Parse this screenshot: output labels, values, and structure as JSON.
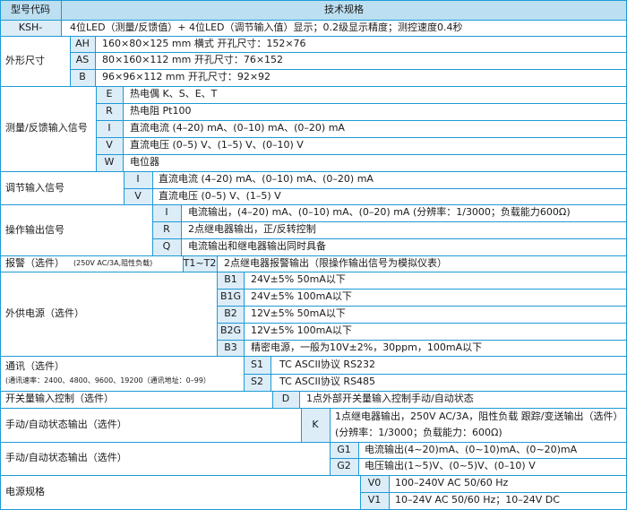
{
  "header": {
    "code_col": "型号代码",
    "spec_col": "技术规格"
  },
  "rows": {
    "model": {
      "code": "KSH-",
      "desc": "4位LED（测量/反馈值）+ 4位LED（调节输入值）显示；0.2级显示精度；测控速度0.4秒"
    },
    "size": {
      "label": "外形尺寸",
      "items": [
        {
          "code": "AH",
          "desc": "160×80×125 mm  横式    开孔尺寸：152×76"
        },
        {
          "code": "AS",
          "desc": "80×160×112 mm      开孔尺寸：76×152"
        },
        {
          "code": "B",
          "desc": "96×96×112 mm       开孔尺寸：92×92"
        }
      ]
    },
    "measure": {
      "label": "测量/反馈输入信号",
      "items": [
        {
          "code": "E",
          "desc": "热电偶 K、S、E、T"
        },
        {
          "code": "R",
          "desc": "热电阻 Pt100"
        },
        {
          "code": "I",
          "desc": "直流电流 (4–20) mA、(0–10) mA、(0–20) mA"
        },
        {
          "code": "V",
          "desc": "直流电压 (0–5) V、(1–5) V、(0–10) V"
        },
        {
          "code": "W",
          "desc": "电位器"
        }
      ]
    },
    "regulate": {
      "label": "调节输入信号",
      "items": [
        {
          "code": "I",
          "desc": "直流电流 (4–20) mA、(0–10) mA、(0–20) mA"
        },
        {
          "code": "V",
          "desc": "直流电压 (0–5) V、(1–5) V"
        }
      ]
    },
    "output": {
      "label": "操作输出信号",
      "items": [
        {
          "code": "I",
          "desc": "电流输出，(4–20) mA、(0–10) mA、(0–20) mA (分辨率：1/3000；负载能力600Ω)"
        },
        {
          "code": "R",
          "desc": "2点继电器输出，正/反转控制"
        },
        {
          "code": "Q",
          "desc": "电流输出和继电器输出同时具备"
        }
      ]
    },
    "alarm": {
      "label": "报警（选件）",
      "note": "(250V AC/3A,阻性负载)",
      "code": "T1~T2",
      "desc": "2点继电器报警输出（限操作输出信号为模拟仪表）"
    },
    "power_out": {
      "label": "外供电源（选件）",
      "items": [
        {
          "code": "B1",
          "desc": "24V±5%  50mA以下"
        },
        {
          "code": "B1G",
          "desc": "24V±5%  100mA以下"
        },
        {
          "code": "B2",
          "desc": "12V±5%  50mA以下"
        },
        {
          "code": "B2G",
          "desc": "12V±5%  100mA以下"
        },
        {
          "code": "B3",
          "desc": "精密电源，一般为10V±2%，30ppm，100mA以下"
        }
      ]
    },
    "comm": {
      "label": "通讯（选件）",
      "note": "(通讯速率：2400、4800、9600、19200（通讯地址：0–99）",
      "items": [
        {
          "code": "S1",
          "desc": "TC ASCII协议 RS232"
        },
        {
          "code": "S2",
          "desc": "TC ASCII协议 RS485"
        }
      ]
    },
    "switch_in": {
      "label": "开关量输入控制（选件）",
      "code": "D",
      "desc": "1点外部开关量输入控制手动/自动状态"
    },
    "manual1": {
      "label": "手动/自动状态输出（选件）",
      "code": "K",
      "desc1": "1点继电器输出，250V AC/3A，阻性负载 跟踪/变送输出（选件）",
      "desc2": "(分辨率：1/3000；负载能力：600Ω)"
    },
    "manual2": {
      "label": "手动/自动状态输出（选件）",
      "items": [
        {
          "code": "G1",
          "desc": "电流输出(4~20)mA、(0~10)mA、(0~20)mA"
        },
        {
          "code": "G2",
          "desc": "电压输出(1~5)V、(0~5)V、(0–10) V"
        }
      ]
    },
    "power": {
      "label": "电源规格",
      "items": [
        {
          "code": "V0",
          "desc": "100–240V AC 50/60 Hz"
        },
        {
          "code": "V1",
          "desc": "10–24V AC 50/60 Hz；10–24V DC"
        }
      ]
    }
  },
  "colors": {
    "grid_line": "#1e9ad6",
    "header_bg": "#bcdff1",
    "code_bg": "#dcedf8"
  }
}
